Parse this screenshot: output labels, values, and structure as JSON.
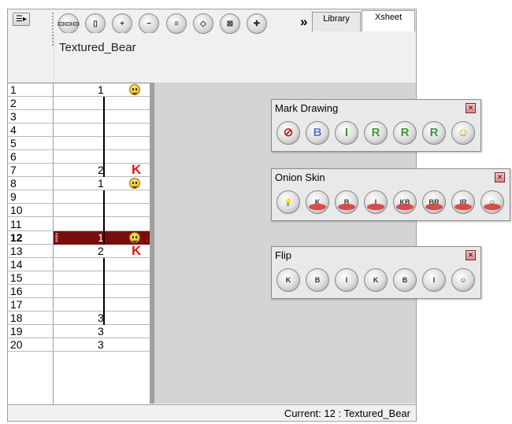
{
  "toolbar": {
    "menu_icon": "xsheet-menu-icon",
    "buttons": [
      {
        "name": "show-thumbnails-icon",
        "glyph": "▭▭▭"
      },
      {
        "name": "toggle-column-icon",
        "glyph": "▯"
      },
      {
        "name": "add-column-icon",
        "glyph": "+"
      },
      {
        "name": "remove-column-icon",
        "glyph": "−"
      },
      {
        "name": "add-frames-icon",
        "glyph": "≡"
      },
      {
        "name": "drawing-paper-icon",
        "glyph": "◇"
      },
      {
        "name": "delete-cell-icon",
        "glyph": "⊠"
      },
      {
        "name": "add-drawing-icon",
        "glyph": "✚"
      }
    ],
    "more_chevron": "»",
    "tabs": [
      {
        "label": "Library"
      },
      {
        "label": "Xsheet"
      }
    ]
  },
  "column": {
    "name": "Textured_Bear"
  },
  "rows": [
    {
      "num": "1",
      "value": "1",
      "mark": "smiley"
    },
    {
      "num": "2",
      "value": "",
      "mark": ""
    },
    {
      "num": "3",
      "value": "",
      "mark": ""
    },
    {
      "num": "4",
      "value": "",
      "mark": ""
    },
    {
      "num": "5",
      "value": "",
      "mark": ""
    },
    {
      "num": "6",
      "value": "",
      "mark": ""
    },
    {
      "num": "7",
      "value": "2",
      "mark": "K"
    },
    {
      "num": "8",
      "value": "1",
      "mark": "smiley"
    },
    {
      "num": "9",
      "value": "",
      "mark": ""
    },
    {
      "num": "10",
      "value": "",
      "mark": ""
    },
    {
      "num": "11",
      "value": "",
      "mark": ""
    },
    {
      "num": "12",
      "value": "1",
      "mark": "smiley"
    },
    {
      "num": "13",
      "value": "2",
      "mark": "K"
    },
    {
      "num": "14",
      "value": "",
      "mark": ""
    },
    {
      "num": "15",
      "value": "",
      "mark": ""
    },
    {
      "num": "16",
      "value": "",
      "mark": ""
    },
    {
      "num": "17",
      "value": "",
      "mark": ""
    },
    {
      "num": "18",
      "value": "3",
      "mark": ""
    },
    {
      "num": "19",
      "value": "3",
      "mark": ""
    },
    {
      "num": "20",
      "value": "3",
      "mark": ""
    }
  ],
  "selected_row": "12",
  "status": {
    "text": "Current: 12 : Textured_Bear"
  },
  "panels": {
    "mark_drawing": {
      "title": "Mark Drawing",
      "buttons": [
        {
          "name": "mark-none-icon",
          "glyph": "⊘"
        },
        {
          "name": "mark-breakdown-icon",
          "glyph": "B"
        },
        {
          "name": "mark-inbetween-icon",
          "glyph": "I"
        },
        {
          "name": "mark-retake-key-icon",
          "glyph": "R"
        },
        {
          "name": "mark-retake-breakdown-icon",
          "glyph": "R"
        },
        {
          "name": "mark-retake-inbetween-icon",
          "glyph": "R"
        },
        {
          "name": "mark-smiley-icon",
          "glyph": "☺"
        }
      ]
    },
    "onion_skin": {
      "title": "Onion Skin",
      "buttons": [
        {
          "name": "onion-toggle-icon",
          "glyph": "💡"
        },
        {
          "name": "onion-key-icon",
          "glyph": "K"
        },
        {
          "name": "onion-breakdown-icon",
          "glyph": "B"
        },
        {
          "name": "onion-inbetween-icon",
          "glyph": "I"
        },
        {
          "name": "onion-key-breakdown-icon",
          "glyph": "KB"
        },
        {
          "name": "onion-breakdown-alt-icon",
          "glyph": "BR"
        },
        {
          "name": "onion-inbetween-alt-icon",
          "glyph": "IR"
        },
        {
          "name": "onion-smiley-icon",
          "glyph": "☺"
        }
      ]
    },
    "flip": {
      "title": "Flip",
      "buttons": [
        {
          "name": "flip-key-icon",
          "glyph": "K"
        },
        {
          "name": "flip-breakdown-icon",
          "glyph": "B"
        },
        {
          "name": "flip-inbetween-icon",
          "glyph": "I"
        },
        {
          "name": "flip-key-alt-icon",
          "glyph": "K"
        },
        {
          "name": "flip-breakdown-alt-icon",
          "glyph": "B"
        },
        {
          "name": "flip-inbetween-alt-icon",
          "glyph": "I"
        },
        {
          "name": "flip-smiley-icon",
          "glyph": "☺"
        }
      ]
    }
  },
  "colors": {
    "selection": "#7a0c0c",
    "mark_red": "#e0151a",
    "background_grey": "#d4d4d4"
  }
}
